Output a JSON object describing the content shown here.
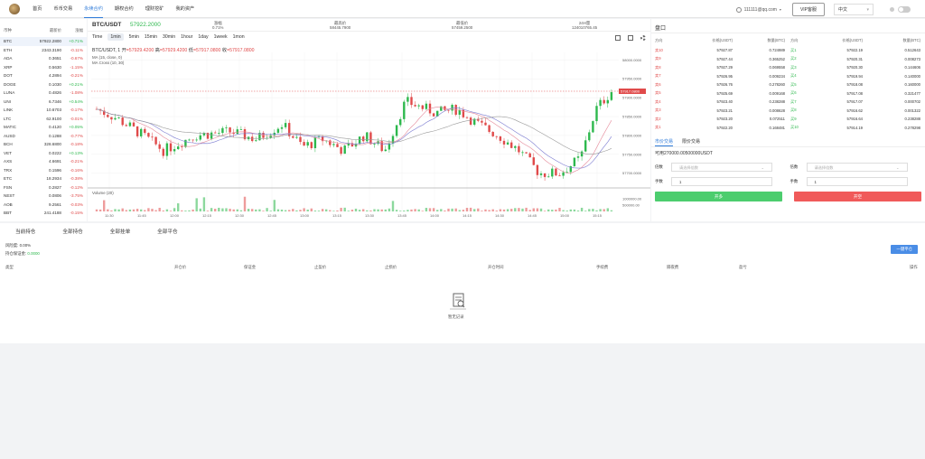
{
  "nav": {
    "items": [
      {
        "label": "首页",
        "active": false
      },
      {
        "label": "币币交易",
        "active": false
      },
      {
        "label": "永续合约",
        "active": true
      },
      {
        "label": "期权合约",
        "active": false
      },
      {
        "label": "理财挖矿",
        "active": false
      },
      {
        "label": "我的资产",
        "active": false
      }
    ],
    "user": "111111@qq.com",
    "vip": "VIP客服",
    "lang": "中文"
  },
  "markets": {
    "headers": [
      "币种",
      "最新价",
      "涨幅"
    ],
    "rows": [
      {
        "sym": "BTC",
        "price": "57922.2800",
        "chg": "+0.71%",
        "dir": "up",
        "sel": true
      },
      {
        "sym": "ETH",
        "price": "2343.3190",
        "chg": "-0.11%",
        "dir": "down"
      },
      {
        "sym": "ADA",
        "price": "0.3651",
        "chg": "-0.67%",
        "dir": "down"
      },
      {
        "sym": "XRP",
        "price": "0.5630",
        "chg": "-1.15%",
        "dir": "down"
      },
      {
        "sym": "DOT",
        "price": "4.2894",
        "chg": "-0.21%",
        "dir": "down"
      },
      {
        "sym": "DOGE",
        "price": "0.1030",
        "chg": "+0.21%",
        "dir": "up"
      },
      {
        "sym": "LUNA",
        "price": "0.4826",
        "chg": "-1.08%",
        "dir": "down"
      },
      {
        "sym": "UNI",
        "price": "6.7346",
        "chg": "+0.54%",
        "dir": "up"
      },
      {
        "sym": "LINK",
        "price": "10.6703",
        "chg": "-0.17%",
        "dir": "down"
      },
      {
        "sym": "LTC",
        "price": "62.9100",
        "chg": "-0.01%",
        "dir": "down"
      },
      {
        "sym": "MATIC",
        "price": "0.4120",
        "chg": "+0.05%",
        "dir": "up"
      },
      {
        "sym": "AUSD",
        "price": "0.1288",
        "chg": "-0.77%",
        "dir": "down"
      },
      {
        "sym": "BCH",
        "price": "328.6800",
        "chg": "-0.18%",
        "dir": "down"
      },
      {
        "sym": "VET",
        "price": "0.0222",
        "chg": "+0.13%",
        "dir": "up"
      },
      {
        "sym": "AXS",
        "price": "4.6691",
        "chg": "-0.21%",
        "dir": "down"
      },
      {
        "sym": "TRX",
        "price": "0.1596",
        "chg": "-0.16%",
        "dir": "down"
      },
      {
        "sym": "ETC",
        "price": "18.2934",
        "chg": "-0.38%",
        "dir": "down"
      },
      {
        "sym": "FSN",
        "price": "0.2827",
        "chg": "-0.12%",
        "dir": "down"
      },
      {
        "sym": "NEST",
        "price": "0.0806",
        "chg": "-3.75%",
        "dir": "down"
      },
      {
        "sym": "AOB",
        "price": "9.2561",
        "chg": "-0.03%",
        "dir": "down"
      },
      {
        "sym": "BBT",
        "price": "241.4188",
        "chg": "-0.15%",
        "dir": "down"
      }
    ]
  },
  "ticker": {
    "pair": "BTC/USDT",
    "price": "57922.2000",
    "change_label": "涨幅",
    "change": "0.71%",
    "high_label": "最高价",
    "high": "58445.7900",
    "low_label": "最低价",
    "low": "57459.2500",
    "vol_label": "24H量",
    "vol": "124010765.45"
  },
  "toolbar": {
    "time_label": "Time",
    "intervals": [
      "1min",
      "5min",
      "15min",
      "30min",
      "1hour",
      "1day",
      "1week",
      "1mon"
    ],
    "selected": "1min"
  },
  "chart_data": {
    "type": "candlestick",
    "legend": {
      "title": "BTC/USDT, 1",
      "open_label": "开",
      "open": "57929.4200",
      "high_label": "高",
      "high": "57929.4200",
      "low_label": "低",
      "low": "57917.0800",
      "close_label": "收",
      "close": "57917.0800",
      "ma": "MA (15, close, 0)",
      "macross": "MA Cross (10, 30)",
      "volume": "Volume (20)"
    },
    "y_ticks": [
      "58000.0000",
      "57950.0000",
      "57900.0000",
      "57850.0000",
      "57800.0000",
      "57750.0000",
      "57700.0000"
    ],
    "y_range": [
      57680,
      58020
    ],
    "last_price": "57917.0800",
    "last_value": 57917.08,
    "volume_ticks": [
      "1000000.00",
      "500000.00"
    ],
    "volume_range": [
      0,
      1300000
    ],
    "x_ticks": [
      "11:30",
      "11:45",
      "12:00",
      "12:15",
      "12:30",
      "12:45",
      "13:00",
      "13:15",
      "13:30",
      "13:45",
      "14:00",
      "14:15",
      "14:30",
      "14:45",
      "15:00",
      "15:15"
    ],
    "colors": {
      "up": "#2db84d",
      "down": "#e04a4a"
    }
  },
  "orderbook": {
    "title": "盘口",
    "headers": [
      "方向",
      "价格(USDT)",
      "数量(BTC)",
      "方向",
      "价格(USDT)",
      "数量(BTC)"
    ],
    "rows": [
      {
        "sd": "卖10",
        "sp": "57927.87",
        "sq": "0.724989",
        "bd": "买1",
        "bp": "57922.19",
        "bq": "0.512643"
      },
      {
        "sd": "卖9",
        "sp": "57927.44",
        "sq": "0.365252",
        "bd": "买2",
        "bp": "57920.31",
        "bq": "0.008273"
      },
      {
        "sd": "卖8",
        "sp": "57927.29",
        "sq": "0.069558",
        "bd": "买3",
        "bp": "57920.30",
        "bq": "0.144606"
      },
      {
        "sd": "卖7",
        "sp": "57926.95",
        "sq": "0.009234",
        "bd": "买4",
        "bp": "57919.94",
        "bq": "0.140000"
      },
      {
        "sd": "卖6",
        "sp": "57926.76",
        "sq": "0.278260",
        "bd": "买5",
        "bp": "57918.08",
        "bq": "0.160000"
      },
      {
        "sd": "卖5",
        "sp": "57925.69",
        "sq": "0.009168",
        "bd": "买6",
        "bp": "57917.08",
        "bq": "0.321477"
      },
      {
        "sd": "卖4",
        "sp": "57923.40",
        "sq": "0.238288",
        "bd": "买7",
        "bp": "57917.07",
        "bq": "0.000702"
      },
      {
        "sd": "卖3",
        "sp": "57923.21",
        "sq": "0.008628",
        "bd": "买8",
        "bp": "57916.62",
        "bq": "0.001322"
      },
      {
        "sd": "卖2",
        "sp": "57923.20",
        "sq": "0.072511",
        "bd": "买9",
        "bp": "57916.64",
        "bq": "0.238288"
      },
      {
        "sd": "卖1",
        "sp": "57922.20",
        "sq": "0.168481",
        "bd": "买10",
        "bp": "57914.19",
        "bq": "0.278298"
      }
    ]
  },
  "trade": {
    "tabs": [
      "市价交易",
      "限价交易"
    ],
    "available": "可用270000.00500000USDT",
    "lever_label": "倍数",
    "lever_placeholder": "请选择倍数",
    "hand_label": "手数",
    "hand_value": "1",
    "buy": "开多",
    "sell": "开空"
  },
  "positions": {
    "tabs": [
      "当前持仓",
      "全部持仓",
      "全部挂单",
      "全部平仓"
    ],
    "risk": "风险度: 0.00%",
    "margin_label": "持仓保证金:",
    "margin_value": "0.0000",
    "close_all": "一键平仓",
    "headers": [
      "类型",
      "开仓价",
      "保证金",
      "止盈价",
      "止损价",
      "开仓时间",
      "手续费",
      "隔夜费",
      "盈亏",
      "操作"
    ],
    "empty": "暂无记录"
  }
}
